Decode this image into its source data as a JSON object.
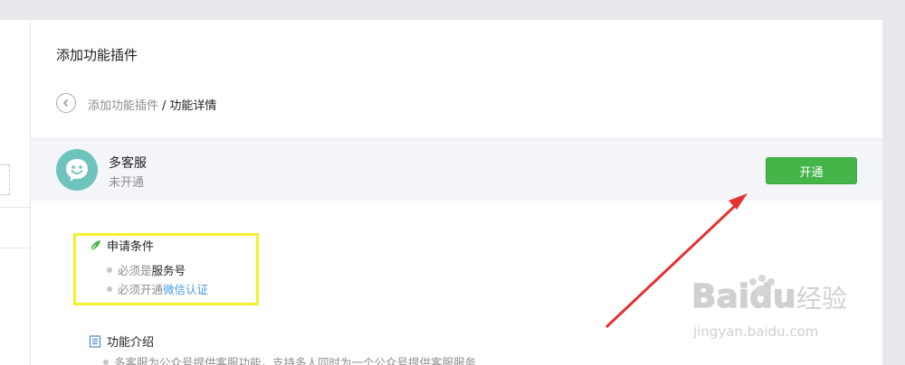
{
  "page": {
    "title": "添加功能插件"
  },
  "breadcrumb": {
    "parent": "添加功能插件",
    "separator": "/",
    "current": "功能详情"
  },
  "plugin": {
    "name": "多客服",
    "status": "未开通",
    "open_button": "开通",
    "brand_color": "#44b549",
    "avatar_color": "#6ec3bd"
  },
  "conditions": {
    "heading": "申请条件",
    "items": [
      {
        "prefix": "必须是",
        "emphasis": "服务号"
      },
      {
        "prefix": "必须开通",
        "link": "微信认证"
      }
    ]
  },
  "intro": {
    "heading": "功能介绍",
    "text": "多客服为公众号提供客服功能，支持多人同时为一个公众号提供客服服务"
  },
  "watermark": {
    "brand": "Baidu",
    "cn": "经验",
    "url": "jingyan.baidu.com"
  },
  "annotation": {
    "box_color": "#f3f02c",
    "arrow_color": "#e33232"
  }
}
